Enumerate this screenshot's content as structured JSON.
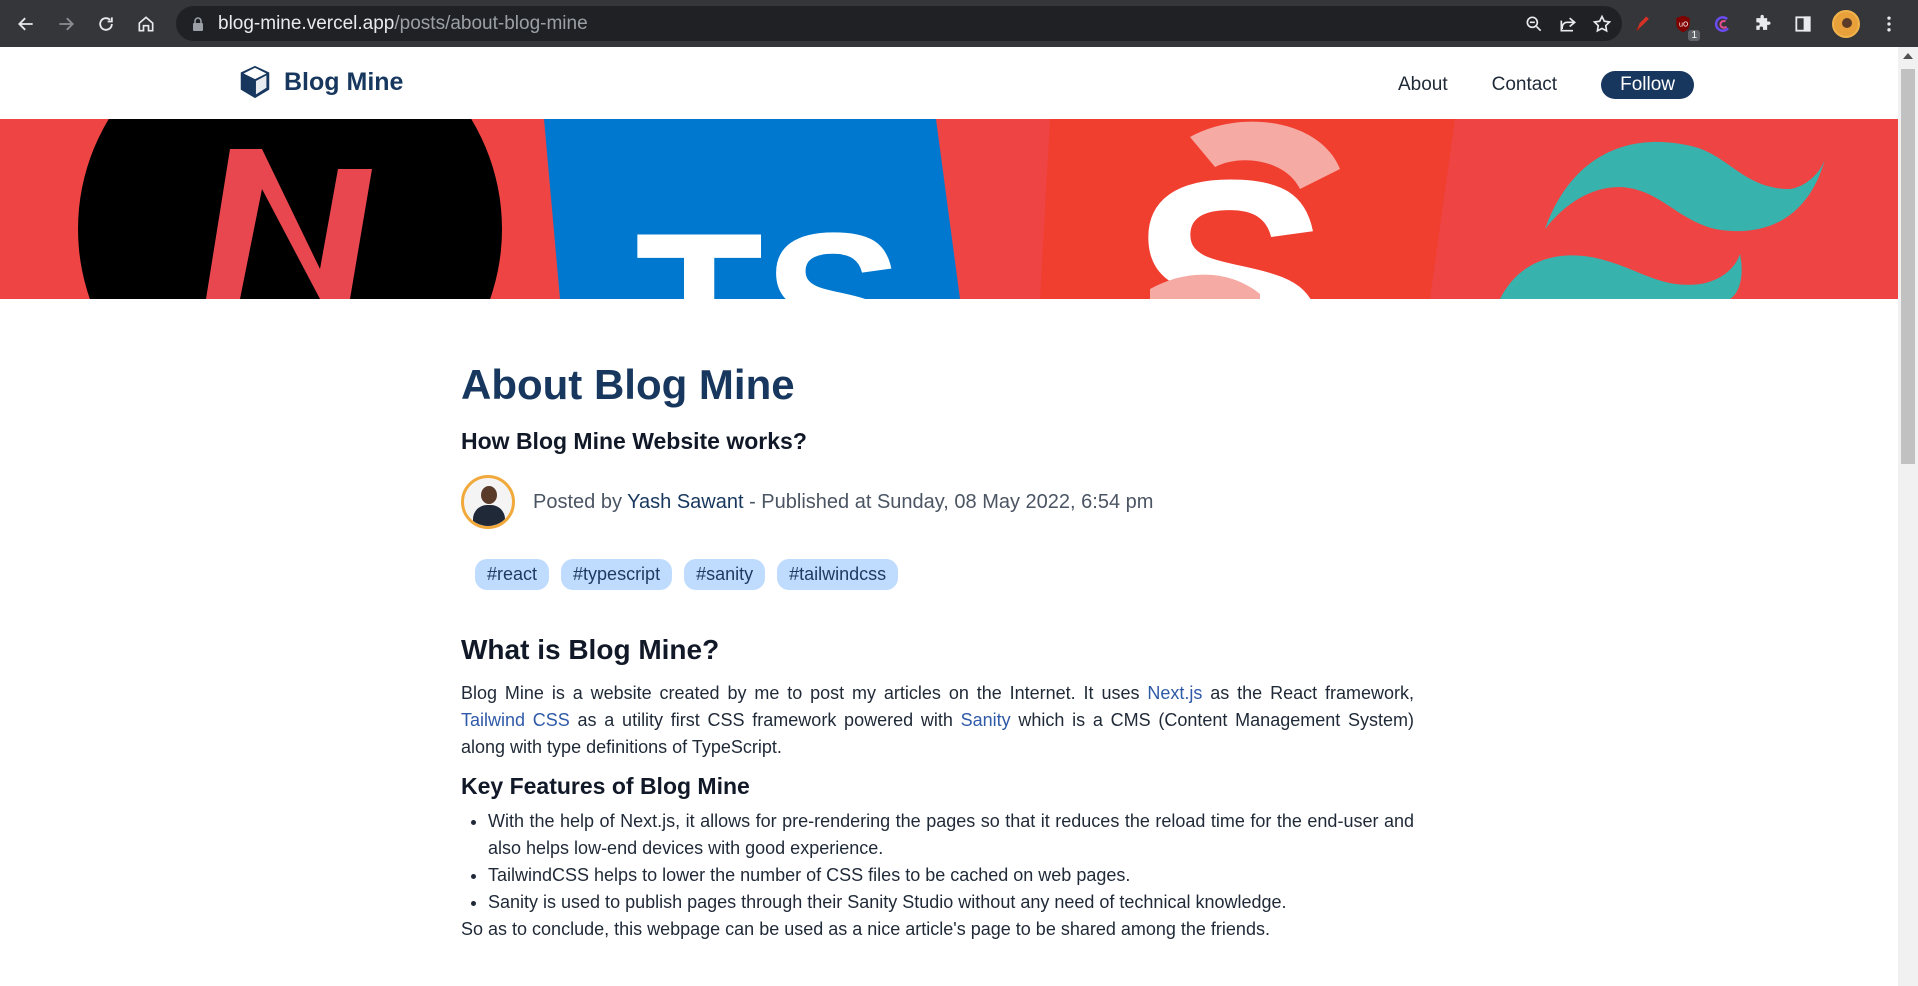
{
  "browser": {
    "url_host": "blog-mine.vercel.app",
    "url_path": "/posts/about-blog-mine",
    "extension_badge": "1"
  },
  "site": {
    "brand": "Blog Mine",
    "nav": {
      "about": "About",
      "contact": "Contact",
      "follow": "Follow"
    }
  },
  "banner": {
    "icons": [
      "nextjs-logo",
      "typescript-logo",
      "sanity-logo",
      "tailwindcss-logo"
    ],
    "letters": {
      "ts": "TS",
      "s": "S"
    },
    "colors": {
      "red": "#ef4444",
      "blue": "#0178cf",
      "black": "#000000",
      "teal": "#38b2ac"
    }
  },
  "post": {
    "title": "About Blog Mine",
    "subtitle": "How Blog Mine Website works?",
    "posted_by_label": "Posted by",
    "author": "Yash Sawant",
    "published_label": "- Published at Sunday, 08 May 2022, 6:54 pm",
    "tags": [
      "#react",
      "#typescript",
      "#sanity",
      "#tailwindcss"
    ]
  },
  "content": {
    "heading1": "What is Blog Mine?",
    "para_part1": "Blog Mine is a website created by me to post my articles on the Internet. It uses ",
    "link_next": "Next.js",
    "para_part2": " as the React framework, ",
    "link_tailwind": "Tailwind CSS",
    "para_part3": " as a utility first CSS framework powered with ",
    "link_sanity": "Sanity",
    "para_part4": " which is a CMS (Content Management System) along with type definitions of TypeScript.",
    "heading2": "Key Features of Blog Mine",
    "features": [
      "With the help of Next.js, it allows for pre-rendering the pages so that it reduces the reload time for the end-user and also helps low-end devices with good experience.",
      "TailwindCSS helps to lower the number of CSS files to be cached on web pages.",
      "Sanity is used to publish pages through their Sanity Studio without any need of technical knowledge."
    ],
    "conclusion": "So as to conclude, this webpage can be used as a nice article's page to be shared among the friends."
  }
}
